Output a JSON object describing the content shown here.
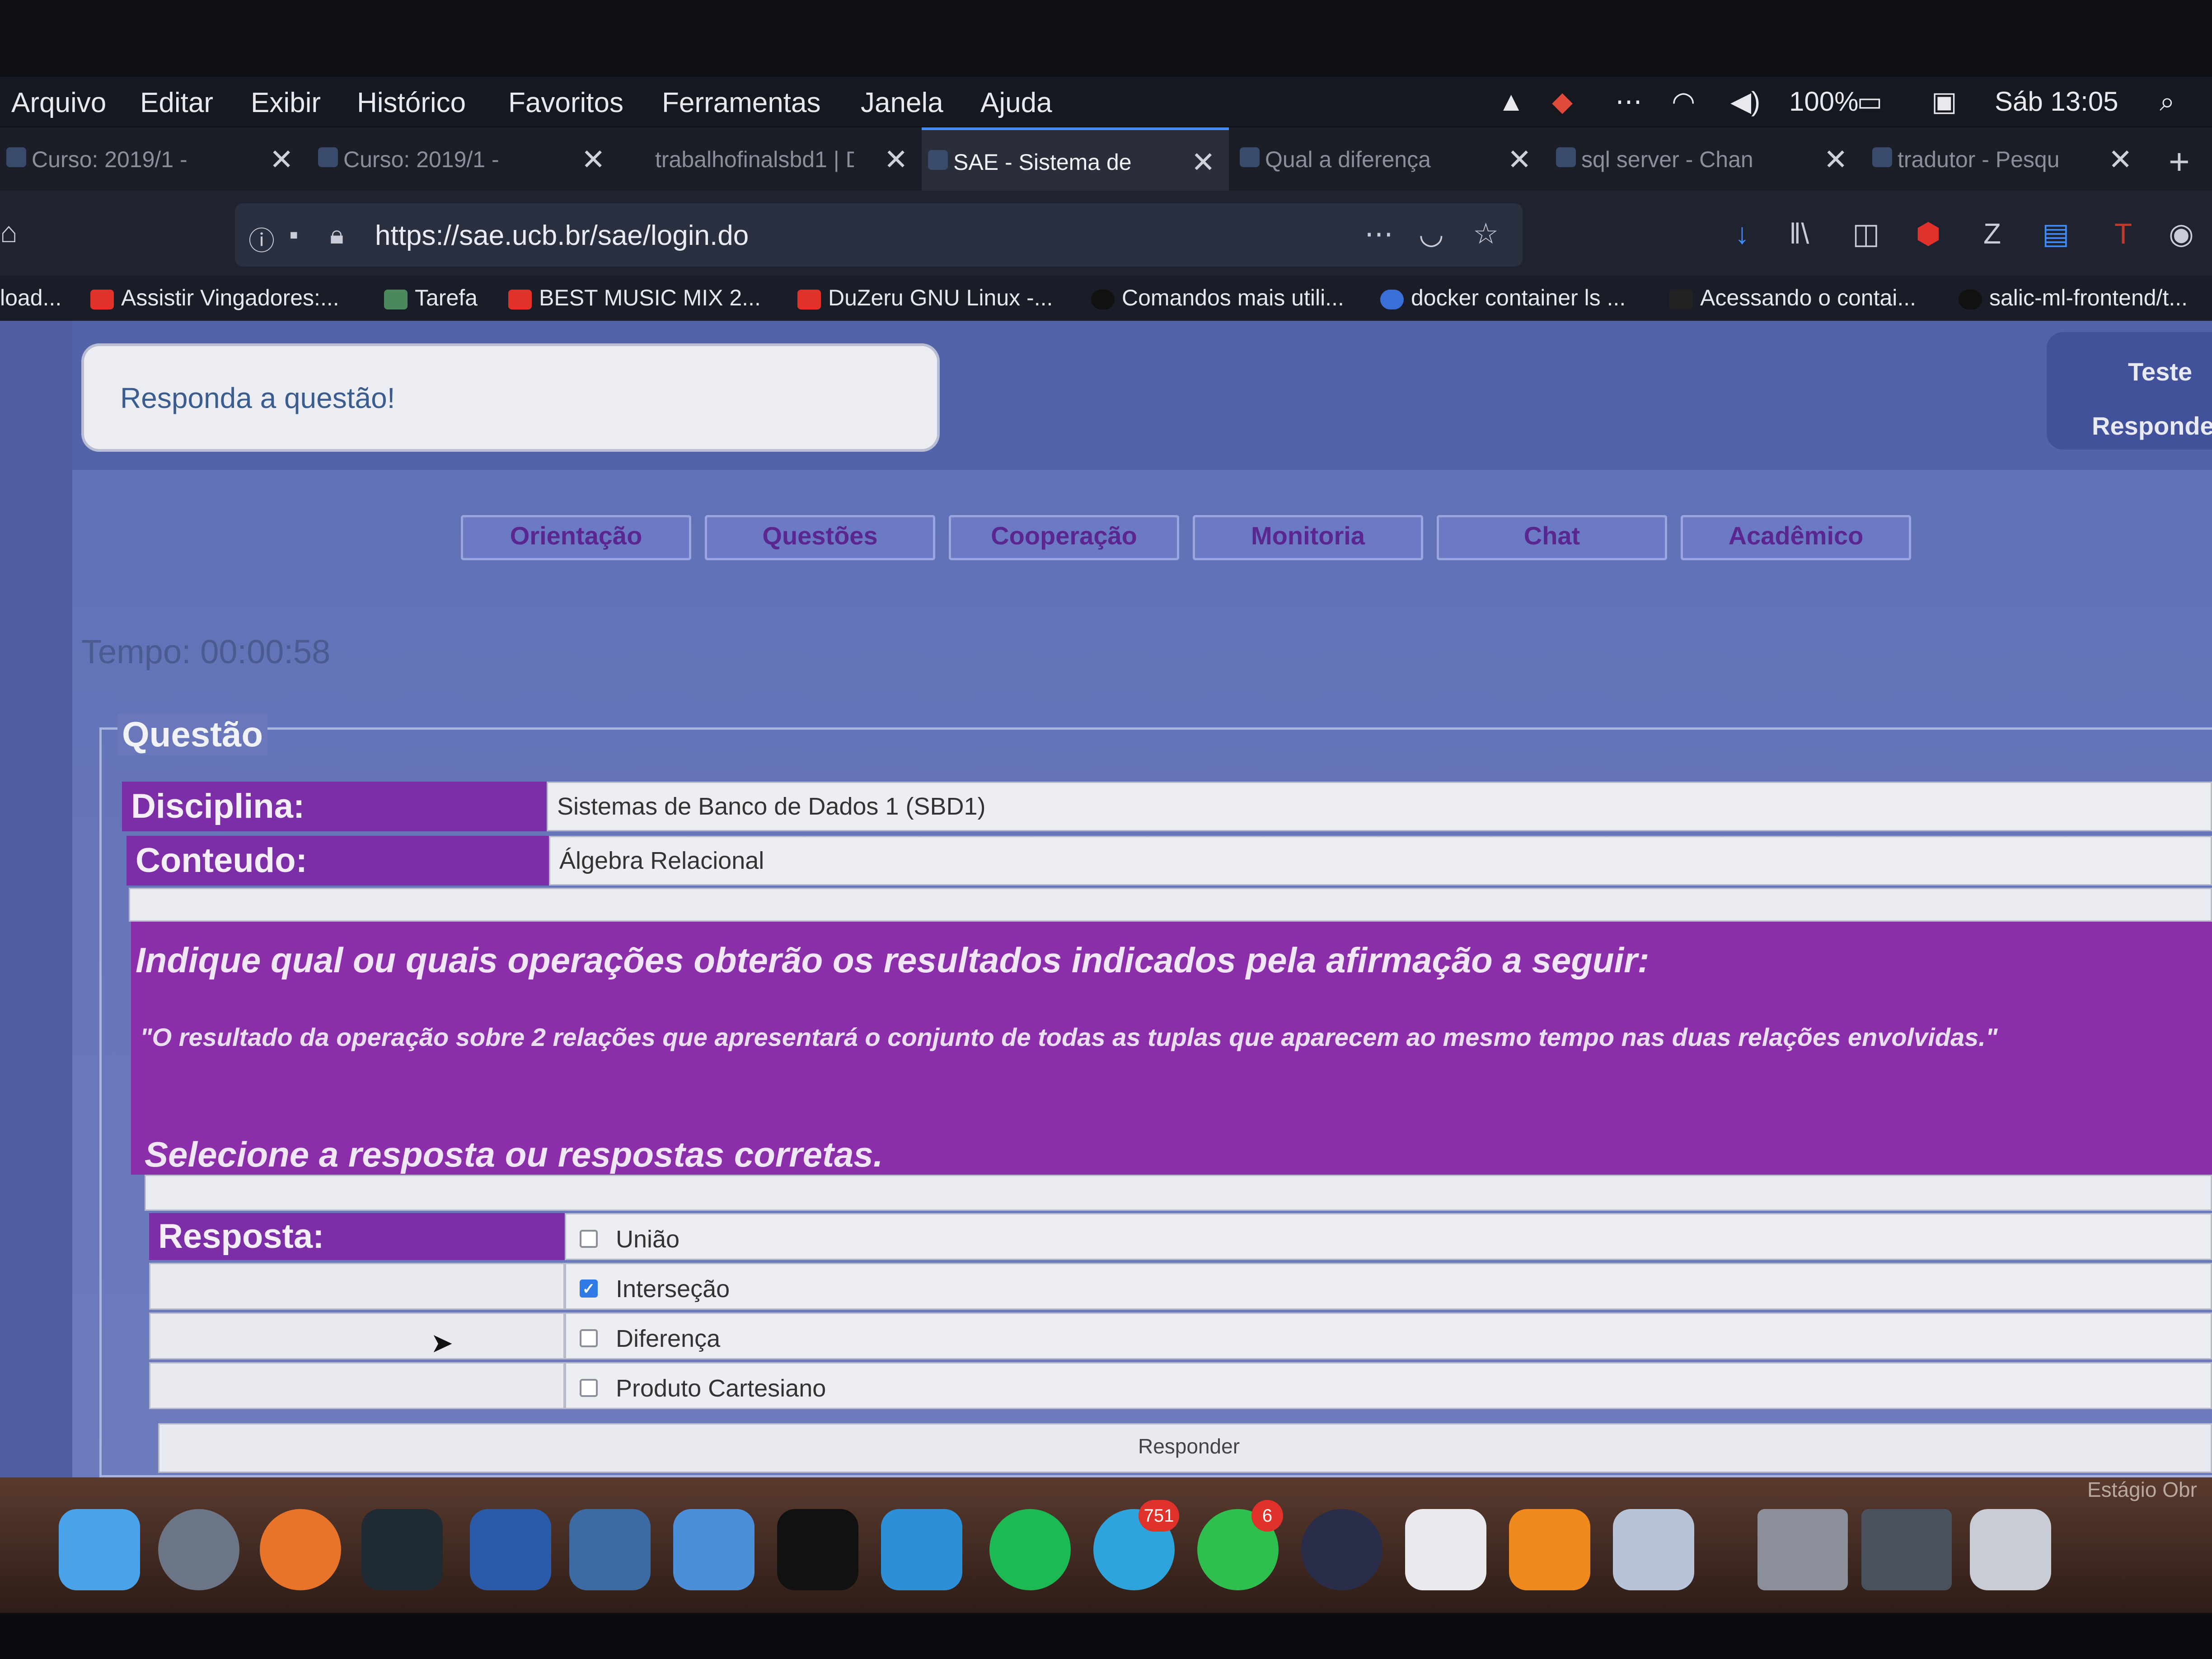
{
  "menubar": {
    "items": [
      "Arquivo",
      "Editar",
      "Exibir",
      "Histórico",
      "Favoritos",
      "Ferramentas",
      "Janela",
      "Ajuda"
    ],
    "battery": "100%",
    "clock": "Sáb 13:05"
  },
  "tabs": [
    {
      "label": "Curso: 2019/1 -"
    },
    {
      "label": "Curso: 2019/1 -"
    },
    {
      "label": "trabalhofinalsbd1 | D"
    },
    {
      "label": "SAE - Sistema de"
    },
    {
      "label": "Qual a diferença"
    },
    {
      "label": "sql server - Chan"
    },
    {
      "label": "tradutor - Pesqu"
    }
  ],
  "address": {
    "url": "https://sae.ucb.br/sae/login.do"
  },
  "bookmarks": [
    {
      "label": "load..."
    },
    {
      "label": "Assistir Vingadores:..."
    },
    {
      "label": "Tarefa"
    },
    {
      "label": "BEST MUSIC MIX 2..."
    },
    {
      "label": "DuZeru GNU Linux -..."
    },
    {
      "label": "Comandos mais utili..."
    },
    {
      "label": "docker container ls ..."
    },
    {
      "label": "Acessando o contai..."
    },
    {
      "label": "salic-ml-frontend/t..."
    }
  ],
  "page": {
    "message": "Responda a questão!",
    "side_panel": {
      "title": "Teste",
      "subtitle": "Responde"
    },
    "nav_tabs": [
      "Orientação",
      "Questões",
      "Cooperação",
      "Monitoria",
      "Chat",
      "Acadêmico"
    ],
    "timer": "Tempo: 00:00:58",
    "question_section": {
      "legend": "Questão",
      "disciplina_label": "Disciplina:",
      "disciplina_value": "Sistemas de Banco de Dados 1 (SBD1)",
      "conteudo_label": "Conteudo:",
      "conteudo_value": "Álgebra Relacional",
      "heading": "Indique qual ou quais operações obterão os resultados indicados pela afirmação a seguir:",
      "statement": "\"O resultado da operação sobre 2 relações que apresentará o conjunto de todas as tuplas que aparecem ao mesmo tempo nas duas relações envolvidas.\"",
      "instruction": "Selecione a resposta ou respostas corretas.",
      "answer_label": "Resposta:",
      "options": [
        {
          "label": "União",
          "checked": false
        },
        {
          "label": "Interseção",
          "checked": true
        },
        {
          "label": "Diferença",
          "checked": false
        },
        {
          "label": "Produto Cartesiano",
          "checked": false
        }
      ],
      "submit_label": "Responder"
    }
  },
  "dock": {
    "telegram_badge": "751",
    "whatsapp_badge": "6",
    "corner_label": "Estágio Obr"
  },
  "colors": {
    "page_bg": "#6575b8",
    "label_purple": "#7c2ea6",
    "question_purple": "#8a2eaa",
    "nav_tab_text": "#5a2790",
    "checkbox_checked": "#2f7ae6"
  }
}
